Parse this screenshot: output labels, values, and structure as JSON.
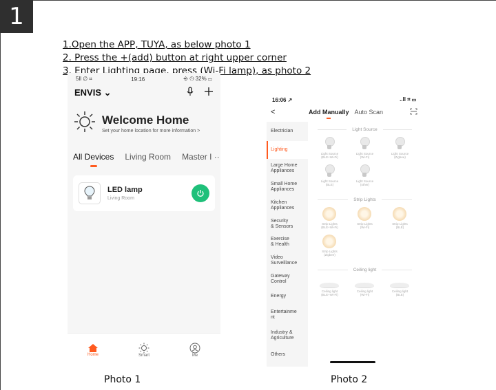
{
  "step_number": "1",
  "instructions": [
    "1.Open the APP, TUYA, as below photo 1",
    "2. Press the +(add) button at right upper corner",
    "3. Enter Lighting page,  press (Wi-Fi lamp), as photo 2"
  ],
  "photo1": {
    "caption": "Photo 1",
    "status": {
      "left": "5ll ∅ ⌗",
      "time": "19:16",
      "right": "⎆ ◷ 32% ▭"
    },
    "brand": "ENVIS ⌄",
    "welcome_title": "Welcome Home",
    "welcome_sub": "Set your home location for more information >",
    "tabs": [
      "All Devices",
      "Living Room",
      "Master I ···"
    ],
    "device": {
      "name": "LED lamp",
      "room": "Living Room"
    },
    "nav": [
      {
        "label": "Home",
        "icon": "home-icon"
      },
      {
        "label": "Smart",
        "icon": "sun-icon"
      },
      {
        "label": "Me",
        "icon": "user-icon"
      }
    ],
    "accent": "#ff5a1f",
    "power_color": "#1fc07a"
  },
  "photo2": {
    "caption": "Photo 2",
    "status": {
      "time": "16:06 ↗",
      "right": "..ll ⌗ ▭"
    },
    "back": "<",
    "tab_active": "Add Manually",
    "tab_other": "Auto Scan",
    "scan_icon": "scan-icon",
    "categories": [
      "Electrician",
      "Lighting",
      "Large Home\nAppliances",
      "Small Home\nAppliances",
      "Kitchen\nAppliances",
      "Security\n& Sensors",
      "Exercise\n& Health",
      "Video\nSurveillance",
      "Gateway\nControl",
      "Energy",
      "Entertainme\nnt",
      "Industry &\nAgriculture",
      "Others"
    ],
    "sections": [
      {
        "title": "Light Source",
        "items": [
          "Light Source\n(BLE+Wi-Fi)",
          "Light Source\n(Wi-Fi)",
          "Light Source\n(Zigbee)",
          "Light Source\n(BLE)",
          "Light Source\n(other)"
        ]
      },
      {
        "title": "Strip Lights",
        "items": [
          "Strip Lights\n(BLE+Wi-Fi)",
          "Strip Lights\n(Wi-Fi)",
          "Strip Lights\n(BLE)",
          "Strip Lights\n(Zigbee)"
        ]
      },
      {
        "title": "Ceiling light",
        "items": [
          "Ceiling light\n(BLE+Wi-Fi)",
          "Ceiling light\n(Wi-Fi)",
          "Ceiling light\n(BLE)"
        ]
      }
    ]
  }
}
